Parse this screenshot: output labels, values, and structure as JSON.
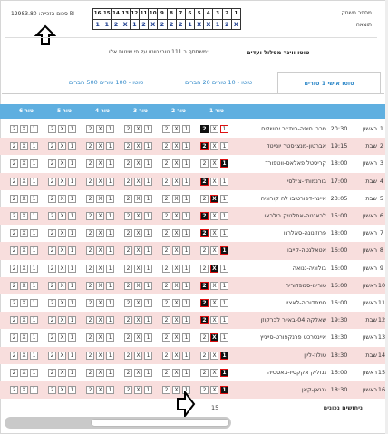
{
  "header": {
    "player_count_label": "מספר משחק",
    "result_label": "תוצאה",
    "match_numbers": [
      "1",
      "2",
      "3",
      "4",
      "5",
      "6",
      "7",
      "8",
      "9",
      "10",
      "11",
      "12",
      "13",
      "14",
      "15",
      "16"
    ],
    "results": [
      "X",
      "2",
      "1",
      "X",
      "X",
      "1",
      "2",
      "2",
      "2",
      "X",
      "2",
      "1",
      "X",
      "2",
      "1",
      "1"
    ],
    "prize": "סכום הזכייה: 12983.80 ₪",
    "toto_name": "טוטו ווינר מסלול ועדים",
    "toto_info": "משתתף ב 111 טורי טוטו על פי שיטות אלו:"
  },
  "tabs": [
    {
      "label": "טוטו אישי 1 טורים",
      "active": true
    },
    {
      "label": "טוטו - 10 טורים 20 חברים",
      "active": false
    },
    {
      "label": "טוטו - 100 טורים 500 חברים",
      "active": false
    }
  ],
  "columns": [
    "1 טור",
    "2 טור",
    "3 טור",
    "4 טור",
    "5 טור",
    "6 טור"
  ],
  "games": [
    {
      "num": "1",
      "day": "ראשון",
      "time": "20:30",
      "name": "מכבי חיפה-בית״ר ירושלים",
      "t1": "2",
      "hit": "1"
    },
    {
      "num": "2",
      "day": "שבת",
      "time": "19:15",
      "name": "אברטון-מנצ׳סטר יונייטד",
      "t1": "2",
      "hit": "2"
    },
    {
      "num": "3",
      "day": "ראשון",
      "time": "18:00",
      "name": "קריסטל פאלאס-ווטפורד",
      "t1": "1",
      "hit": "1"
    },
    {
      "num": "4",
      "day": "שבת",
      "time": "17:00",
      "name": "בורנמות׳-צ׳לסי",
      "t1": "2",
      "hit": "2"
    },
    {
      "num": "5",
      "day": "שבת",
      "time": "23:05",
      "name": "איינר-דפורטיבו לה קורוניה",
      "t1": "X",
      "hit": "X"
    },
    {
      "num": "6",
      "day": "ראשון",
      "time": "15:00",
      "name": "לבאנטה-אתלטיק בילבאו",
      "t1": "2",
      "hit": "2"
    },
    {
      "num": "7",
      "day": "ראשון",
      "time": "18:00",
      "name": "פרוזינונה-סאלרנו",
      "t1": "2",
      "hit": "2"
    },
    {
      "num": "8",
      "day": "ראשון",
      "time": "16:00",
      "name": "אטאלנטה-קייבו",
      "t1": "1",
      "hit": "1"
    },
    {
      "num": "9",
      "day": "ראשון",
      "time": "16:00",
      "name": "בולוניה-גנואה",
      "t1": "X",
      "hit": "X"
    },
    {
      "num": "10",
      "day": "ראשון",
      "time": "16:00",
      "name": "טורינו-סמפדוריה",
      "t1": "2",
      "hit": "2"
    },
    {
      "num": "11",
      "day": "ראשון",
      "time": "16:00",
      "name": "סמפדוריה-לאציו",
      "t1": "2",
      "hit": "2"
    },
    {
      "num": "12",
      "day": "שבת",
      "time": "19:30",
      "name": "שאלקה 04-באייר לברקוזן",
      "t1": "2",
      "hit": "2"
    },
    {
      "num": "13",
      "day": "ראשון",
      "time": "18:30",
      "name": "איינטרכט פרנקפורט-סייניץ",
      "t1": "X",
      "hit": "X"
    },
    {
      "num": "14",
      "day": "שבת",
      "time": "18:30",
      "name": "טולוז-ליון",
      "t1": "1",
      "hit": "1"
    },
    {
      "num": "15",
      "day": "ראשון",
      "time": "16:00",
      "name": "גנזליק אקקסיו-באסטיה",
      "t1": "1",
      "hit": "1"
    },
    {
      "num": "16",
      "day": "ראשון",
      "time": "18:30",
      "name": "גנגאן-קאן",
      "t1": "1",
      "hit": "1"
    }
  ],
  "footer": {
    "correct_label": "ניחושים נכונים",
    "correct_count": "15"
  },
  "colors": {
    "header_bar": "#5fafe0",
    "row_alt": "#f8dedd",
    "tab_text": "#2f88c8",
    "hit_border": "#dd1111"
  }
}
